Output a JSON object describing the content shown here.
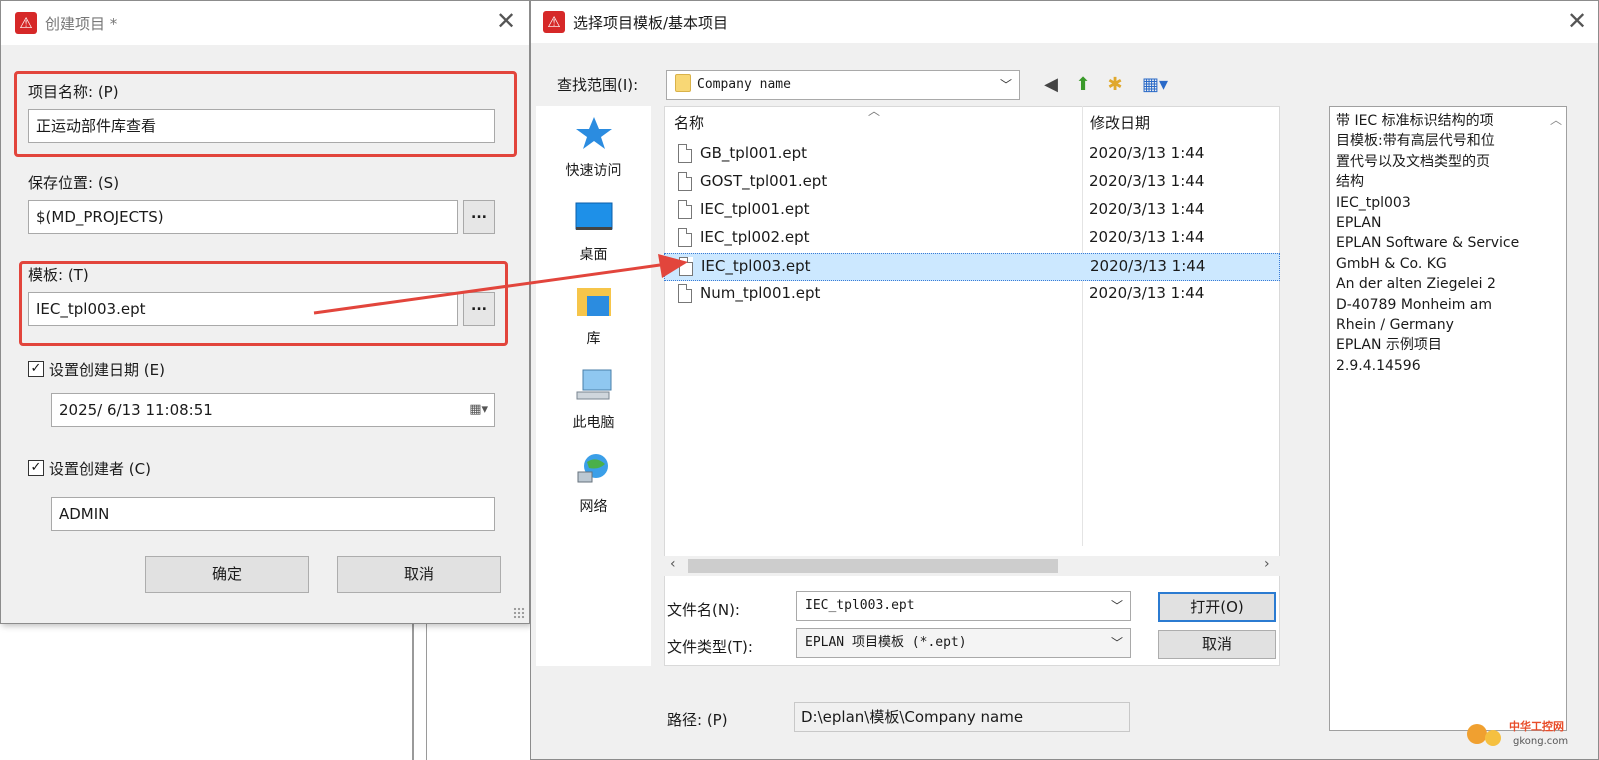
{
  "create_dialog": {
    "title": "创建项目 *",
    "close": "✕",
    "project_name": {
      "label": "项目名称: (P)",
      "value": "正运动部件库查看"
    },
    "save_location": {
      "label": "保存位置: (S)",
      "value": "$(MD_PROJECTS)",
      "browse": "..."
    },
    "template": {
      "label": "模板: (T)",
      "value": "IEC_tpl003.ept",
      "browse": "..."
    },
    "set_created_date": {
      "label": "设置创建日期 (E)",
      "checked": true,
      "value": "2025/  6/13 11:08:51"
    },
    "set_creator": {
      "label": "设置创建者 (C)",
      "checked": true,
      "value": "ADMIN"
    },
    "ok": "确定",
    "cancel": "取消"
  },
  "file_dialog": {
    "title": "选择项目模板/基本项目",
    "close": "✕",
    "lookin_label": "查找范围(I):",
    "lookin_value": "Company name",
    "places": [
      {
        "name": "快速访问",
        "icon": "star-icon"
      },
      {
        "name": "桌面",
        "icon": "desktop-icon"
      },
      {
        "name": "库",
        "icon": "library-icon"
      },
      {
        "name": "此电脑",
        "icon": "computer-icon"
      },
      {
        "name": "网络",
        "icon": "network-icon"
      }
    ],
    "columns": {
      "name": "名称",
      "date": "修改日期"
    },
    "files": [
      {
        "name": "GB_tpl001.ept",
        "date": "2020/3/13 1:44",
        "selected": false
      },
      {
        "name": "GOST_tpl001.ept",
        "date": "2020/3/13 1:44",
        "selected": false
      },
      {
        "name": "IEC_tpl001.ept",
        "date": "2020/3/13 1:44",
        "selected": false
      },
      {
        "name": "IEC_tpl002.ept",
        "date": "2020/3/13 1:44",
        "selected": false
      },
      {
        "name": "IEC_tpl003.ept",
        "date": "2020/3/13 1:44",
        "selected": true
      },
      {
        "name": "Num_tpl001.ept",
        "date": "2020/3/13 1:44",
        "selected": false
      }
    ],
    "filename_label": "文件名(N):",
    "filename_value": "IEC_tpl003.ept",
    "filetype_label": "文件类型(T):",
    "filetype_value": "EPLAN 项目模板 (*.ept)",
    "open": "打开(O)",
    "cancel": "取消",
    "path_label": "路径: (P)",
    "path_value": "D:\\eplan\\模板\\Company name",
    "info_lines": [
      "带 IEC 标准标识结构的项",
      "目模板:带有高层代号和位",
      "置代号以及文档类型的页",
      "结构",
      "IEC_tpl003",
      "EPLAN",
      "EPLAN Software & Service",
      "GmbH & Co. KG",
      "An der alten Ziegelei 2",
      "D-40789 Monheim am",
      "Rhein / Germany",
      "EPLAN 示例项目",
      "2.9.4.14596"
    ]
  },
  "watermark": {
    "text_cn": "中华工控网",
    "text_url": "gkong.com"
  },
  "colors": {
    "highlight_red": "#e2453c",
    "selection_blue": "#cce8ff",
    "app_red": "#d62828"
  }
}
